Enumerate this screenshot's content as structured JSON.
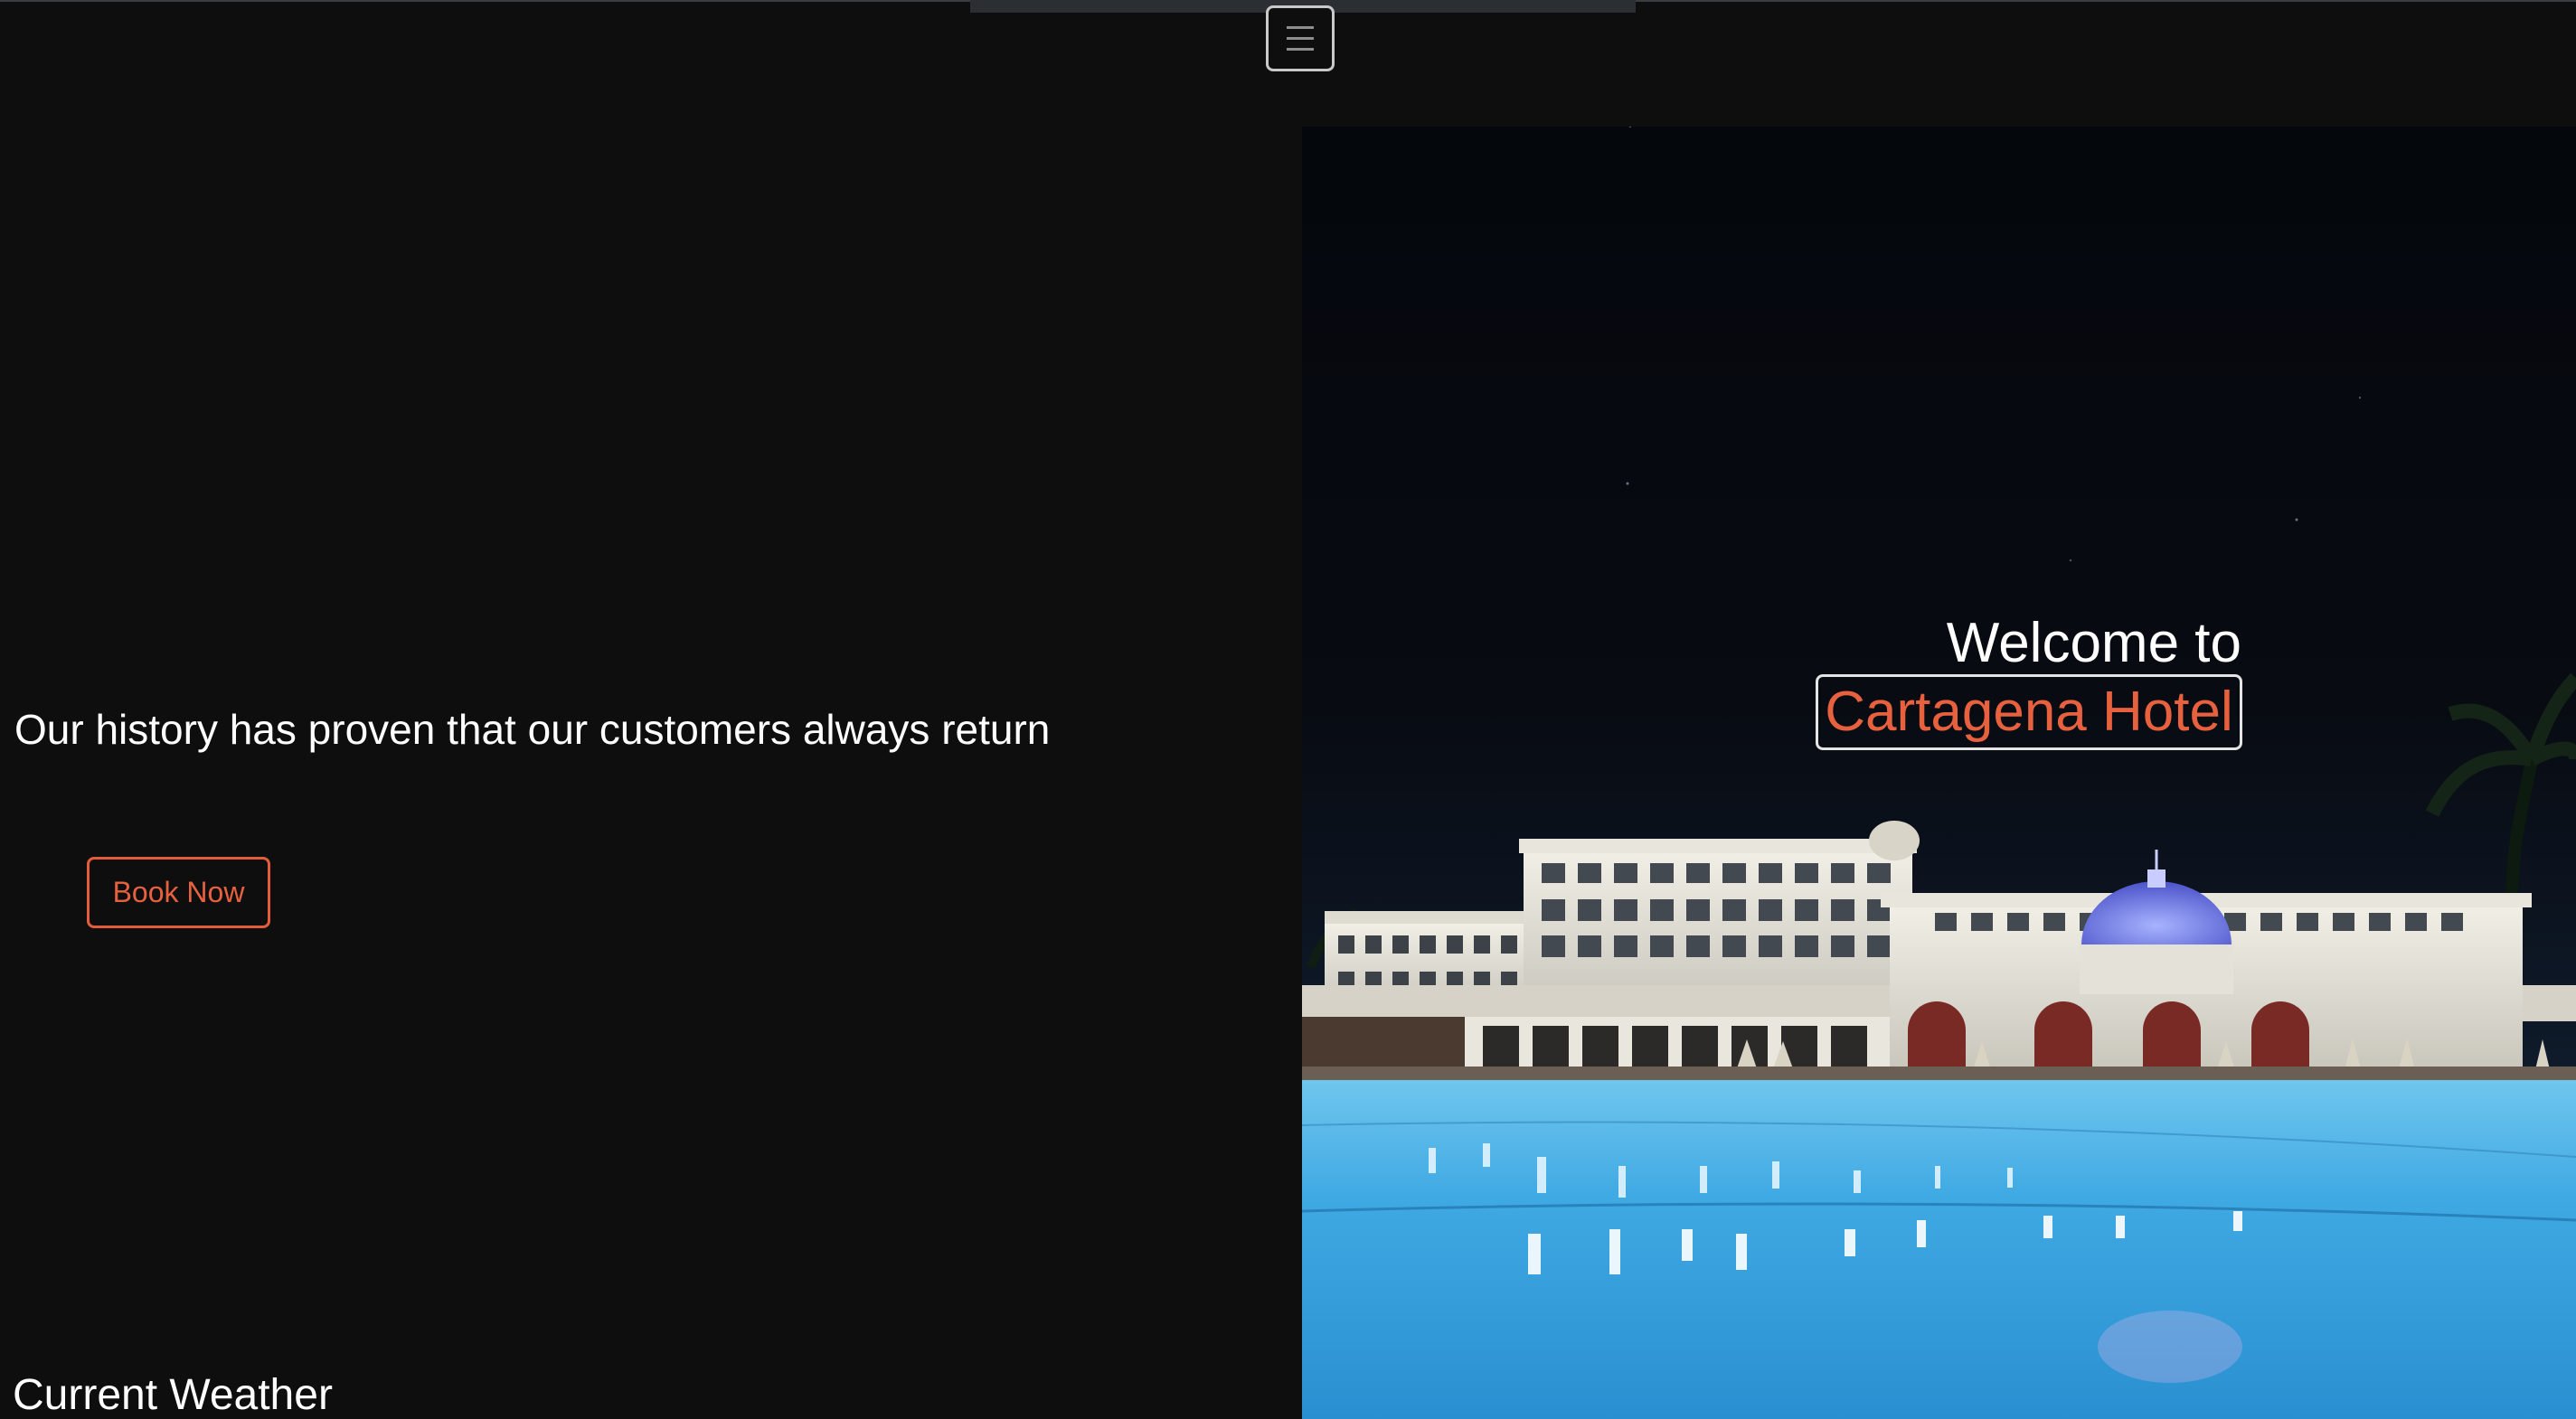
{
  "nav": {
    "toggle_icon": "hamburger-menu-icon"
  },
  "hero": {
    "tagline": "Our history has proven that our customers always return",
    "book_button_label": "Book Now",
    "welcome_text": "Welcome to",
    "hotel_name": "Cartagena Hotel",
    "image_subject": "hotel-pool-night-photo"
  },
  "weather": {
    "heading": "Current Weather"
  },
  "colors": {
    "background": "#0e0e0e",
    "accent": "#e8613e",
    "text": "#ffffff",
    "nav_border": "#c9c9c9"
  }
}
